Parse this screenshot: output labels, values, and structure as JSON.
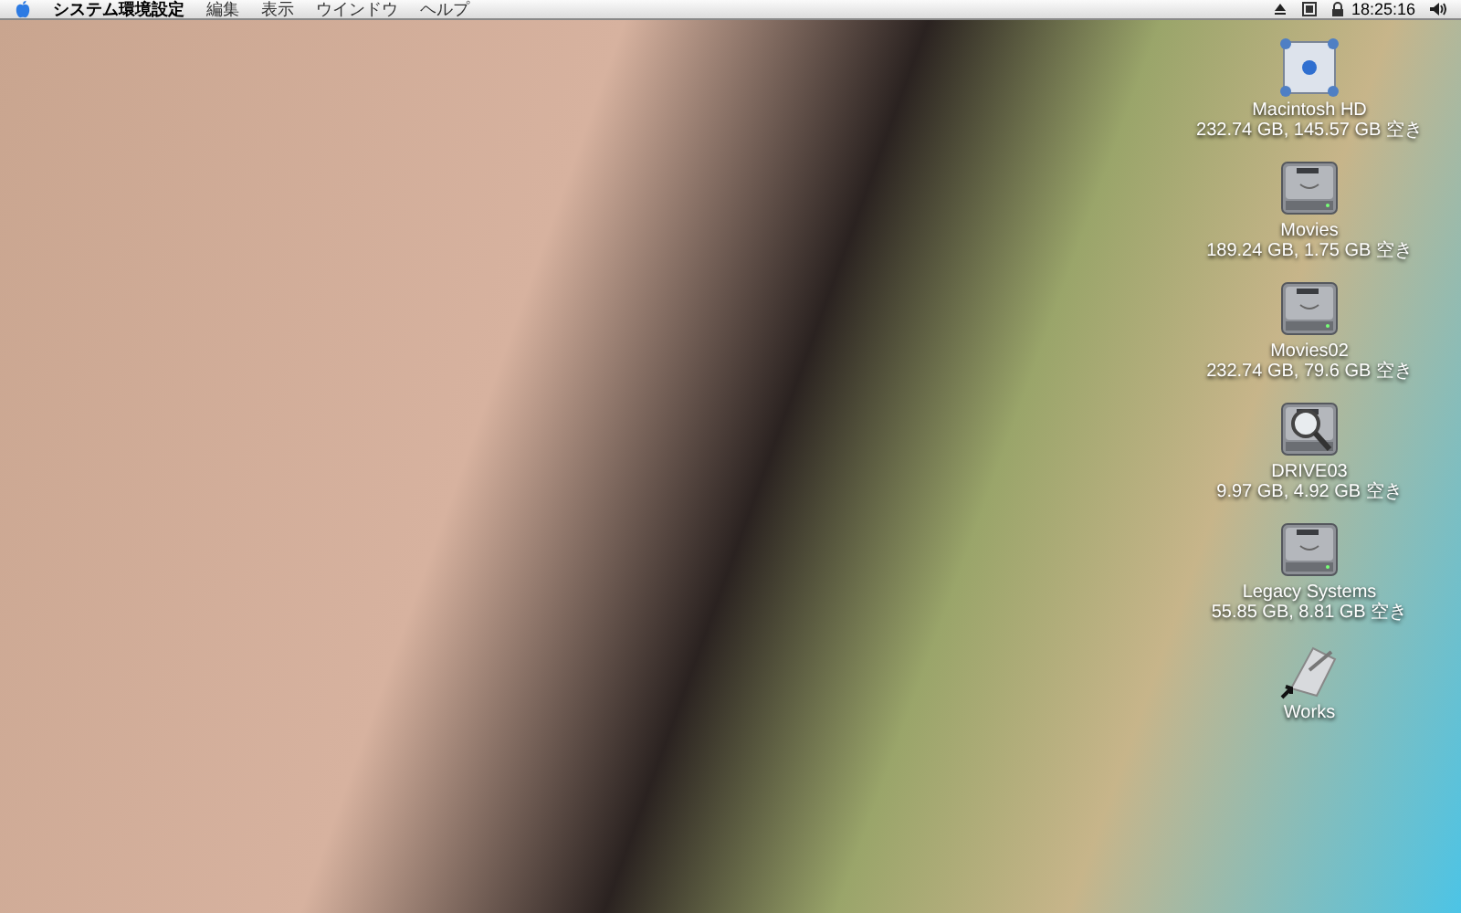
{
  "menubar": {
    "menus": [
      {
        "label": "システム環境設定",
        "app": true
      },
      {
        "label": "編集",
        "app": false
      },
      {
        "label": "表示",
        "app": false
      },
      {
        "label": "ウインドウ",
        "app": false
      },
      {
        "label": "ヘルプ",
        "app": false
      }
    ],
    "clock": "18:25:16"
  },
  "desktop_icons": [
    {
      "kind": "server",
      "name": "Macintosh HD",
      "info": "232.74 GB, 145.57 GB 空き"
    },
    {
      "kind": "drive",
      "name": "Movies",
      "info": "189.24 GB, 1.75 GB 空き"
    },
    {
      "kind": "drive",
      "name": "Movies02",
      "info": "232.74 GB, 79.6 GB 空き"
    },
    {
      "kind": "search-drive",
      "name": "DRIVE03",
      "info": "9.97 GB, 4.92 GB 空き"
    },
    {
      "kind": "drive",
      "name": "Legacy Systems",
      "info": "55.85 GB, 8.81 GB 空き"
    },
    {
      "kind": "alias",
      "name": "Works"
    }
  ]
}
